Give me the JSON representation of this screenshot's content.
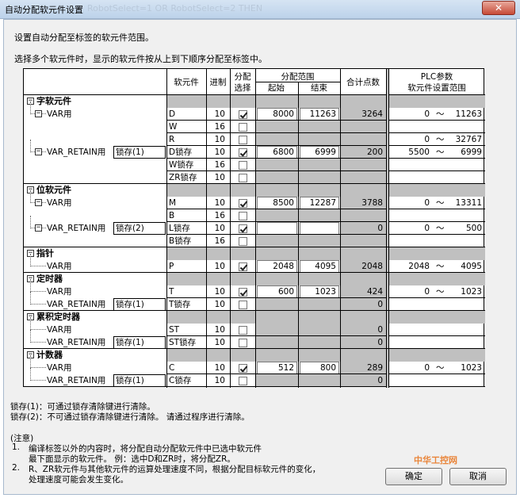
{
  "window": {
    "title": "自动分配软元件设置",
    "background_title": "RobotSelect=1 OR RobotSelect=2 THEN",
    "close_glyph": "✕"
  },
  "intro": {
    "line1": "设置自动分配至标签的软元件范围。",
    "line2": "选择多个软元件时，显示的软元件按从上到下顺序分配至标签中。"
  },
  "headers": {
    "device": "软元件",
    "radix": "进制",
    "assign_select_1": "分配",
    "assign_select_2": "选择",
    "range": "分配范围",
    "start": "起始",
    "end": "结束",
    "total": "合计点数",
    "plc_1": "PLC参数",
    "plc_2": "软元件设置范围"
  },
  "lock_buttons": {
    "lock1": "锁存(1)",
    "lock2": "锁存(2)"
  },
  "sections": [
    {
      "label": "字软元件"
    },
    {
      "label": "位软元件"
    },
    {
      "label": "指针"
    },
    {
      "label": "定时器"
    },
    {
      "label": "累积定时器"
    },
    {
      "label": "计数器"
    }
  ],
  "tree": {
    "var": "VAR用",
    "var_retain": "VAR_RETAIN用",
    "expander_minus": "−"
  },
  "rows": [
    {
      "device": "D",
      "radix": "10",
      "checked": true,
      "start": "8000",
      "end": "11263",
      "total": "3264",
      "plc_min": "0",
      "plc_max": "11263"
    },
    {
      "device": "W",
      "radix": "16",
      "checked": false
    },
    {
      "device": "R",
      "radix": "10",
      "checked": false,
      "plc_min": "0",
      "plc_max": "32767"
    },
    {
      "device": "D锁存",
      "radix": "10",
      "checked": true,
      "start": "6800",
      "end": "6999",
      "total": "200",
      "plc_min": "5500",
      "plc_max": "6999"
    },
    {
      "device": "W锁存",
      "radix": "16",
      "checked": false
    },
    {
      "device": "ZR锁存",
      "radix": "10",
      "checked": false
    },
    {
      "device": "M",
      "radix": "10",
      "checked": true,
      "start": "8500",
      "end": "12287",
      "total": "3788",
      "plc_min": "0",
      "plc_max": "13311"
    },
    {
      "device": "B",
      "radix": "16",
      "checked": false
    },
    {
      "device": "L锁存",
      "radix": "10",
      "checked": true,
      "start": "",
      "end": "",
      "total": "0",
      "plc_min": "0",
      "plc_max": "500"
    },
    {
      "device": "B锁存",
      "radix": "16",
      "checked": false
    },
    {
      "device": "P",
      "radix": "10",
      "checked": true,
      "start": "2048",
      "end": "4095",
      "total": "2048",
      "plc_min": "2048",
      "plc_max": "4095"
    },
    {
      "device": "T",
      "radix": "10",
      "checked": true,
      "start": "600",
      "end": "1023",
      "total": "424",
      "plc_min": "0",
      "plc_max": "1023"
    },
    {
      "device": "T锁存",
      "radix": "10",
      "checked": false,
      "total": "0"
    },
    {
      "device": "ST",
      "radix": "10",
      "checked": false,
      "total": "0"
    },
    {
      "device": "ST锁存",
      "radix": "10",
      "checked": false,
      "total": "0"
    },
    {
      "device": "C",
      "radix": "10",
      "checked": true,
      "start": "512",
      "end": "800",
      "total": "289",
      "plc_min": "0",
      "plc_max": "1023"
    },
    {
      "device": "C锁存",
      "radix": "10",
      "checked": false,
      "total": "0"
    }
  ],
  "tilde": "～",
  "notes": {
    "lock1": "锁存(1)：可通过锁存清除键进行清除。",
    "lock2": "锁存(2)：不可通过锁存清除键进行清除。 请通过程序进行清除。",
    "heading": "(注意)",
    "n1_num": "1.",
    "n1_line1": "编译标签以外的内容时，将分配自动分配软元件中已选中软元件",
    "n1_line2": "最下面显示的软元件。    例：选中D和ZR时，将分配ZR。",
    "n2_num": "2.",
    "n2_line1": "R、ZR软元件与其他软元件的运算处理速度不同，根据分配目标软元件的变化，",
    "n2_line2": "处理速度可能会发生变化。"
  },
  "buttons": {
    "ok": "确定",
    "cancel": "取消"
  },
  "watermark": "中华工控网"
}
